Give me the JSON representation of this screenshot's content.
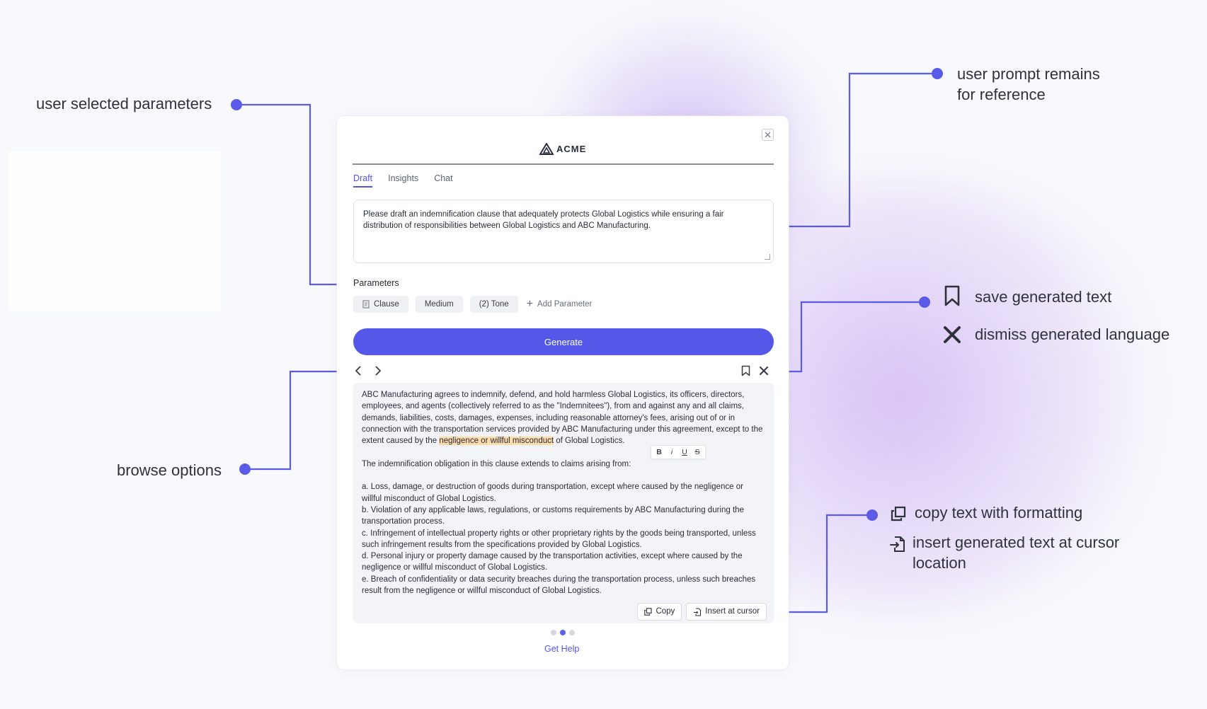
{
  "panel": {
    "brand": "ACME",
    "tabs": [
      {
        "label": "Draft",
        "active": true
      },
      {
        "label": "Insights",
        "active": false
      },
      {
        "label": "Chat",
        "active": false
      }
    ],
    "prompt_text": "Please draft an indemnification clause that adequately protects Global Logistics while ensuring a fair distribution of responsibilities between Global Logistics and ABC Manufacturing.",
    "parameters_label": "Parameters",
    "parameters": [
      {
        "label": "Clause",
        "icon": "document-icon"
      },
      {
        "label": "Medium"
      },
      {
        "label": "(2) Tone"
      }
    ],
    "add_parameter_label": "Add Parameter",
    "generate_label": "Generate",
    "result": {
      "p1_before": "ABC Manufacturing agrees to indemnify, defend, and hold harmless Global Logistics, its officers, directors, employees, and agents (collectively referred to as the \"Indemnitees\"), from and against any and all claims, demands, liabilities, costs, damages, expenses, including reasonable attorney's fees, arising out of or in connection with the transportation services provided by ABC Manufacturing under this agreement, except to the extent caused by the",
      "p1_highlight": "negligence or willful misconduct",
      "p1_after": "of Global Logistics.",
      "p2": "The indemnification obligation in this clause extends to claims arising from:",
      "items": [
        "a. Loss, damage, or destruction of goods during transportation, except where caused by the negligence or willful misconduct of Global Logistics.",
        "b. Violation of any applicable laws, regulations, or customs requirements by ABC Manufacturing during the transportation process.",
        "c. Infringement of intellectual property rights or other proprietary rights by the goods being transported, unless such infringement results from the specifications provided by Global Logistics.",
        "d. Personal injury or property damage caused by the transportation activities, except where caused by the negligence or willful misconduct of Global Logistics.",
        "e. Breach of confidentiality or data security breaches during the transportation process, unless such breaches result from the negligence or willful misconduct of Global Logistics."
      ],
      "format_bar": [
        "B",
        "i",
        "U",
        "S"
      ],
      "copy_label": "Copy",
      "insert_label": "Insert at cursor"
    },
    "pagination": {
      "total": 3,
      "current": 2
    },
    "help_label": "Get Help"
  },
  "annotations": {
    "user_selected_parameters": "user selected parameters",
    "user_prompt_line1": "user prompt remains",
    "user_prompt_line2": "for reference",
    "save_generated_text": "save generated text",
    "dismiss_generated_language": "dismiss generated language",
    "browse_options": "browse options",
    "copy_text_with_formatting": "copy text with formatting",
    "insert_line1": "insert generated text at cursor",
    "insert_line2": "location"
  },
  "colors": {
    "accent": "#5457e8",
    "highlight": "#fbdcaa",
    "annotation_line": "#5a5ce8"
  }
}
